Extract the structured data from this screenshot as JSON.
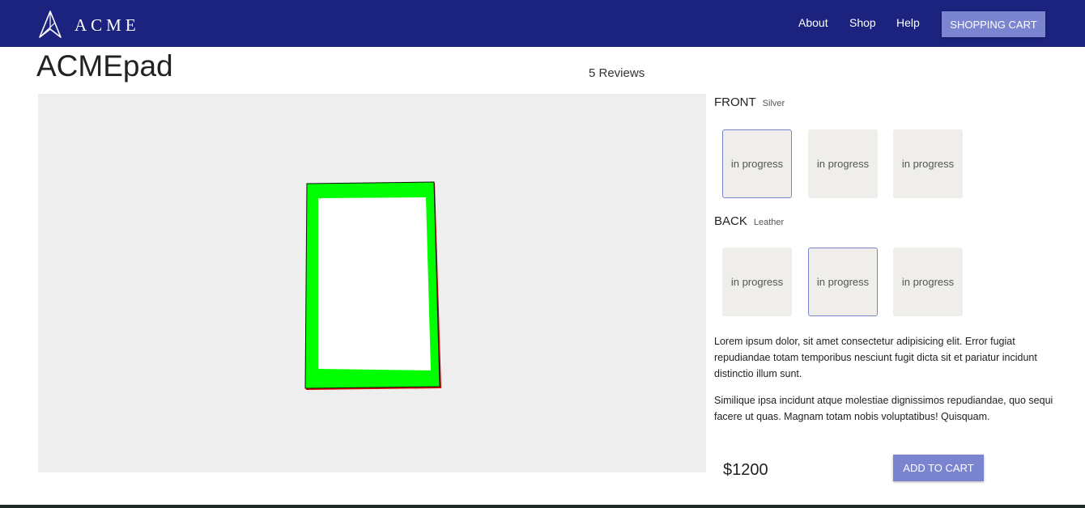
{
  "header": {
    "brand": "ACME",
    "nav": {
      "about": "About",
      "shop": "Shop",
      "help": "Help"
    },
    "cart_button": "SHOPPING CART"
  },
  "product": {
    "title": "ACMEpad",
    "reviews": "5 Reviews",
    "front": {
      "label": "FRONT",
      "selected": "Silver",
      "options": [
        "in progress",
        "in progress",
        "in progress"
      ],
      "selected_index": 0
    },
    "back": {
      "label": "BACK",
      "selected": "Leather",
      "options": [
        "in progress",
        "in progress",
        "in progress"
      ],
      "selected_index": 1
    },
    "description": [
      "Lorem ipsum dolor, sit amet consectetur adipisicing elit. Error fugiat repudiandae totam temporibus nesciunt fugit dicta sit et pariatur incidunt distinctio illum sunt.",
      "Similique ipsa incidunt atque molestiae dignissimos repudiandae, quo sequi facere ut quas. Magnam totam nobis voluptatibus! Quisquam."
    ],
    "price": "$1200",
    "add_to_cart": "ADD TO CART"
  },
  "colors": {
    "navbar": "#1b237e",
    "accent": "#7b84cf",
    "viewer_bg": "#eeeeee",
    "device_frame": "#00ff00",
    "device_edge": "#dd0000"
  },
  "icons": {
    "logo": "acme-logo-icon"
  }
}
